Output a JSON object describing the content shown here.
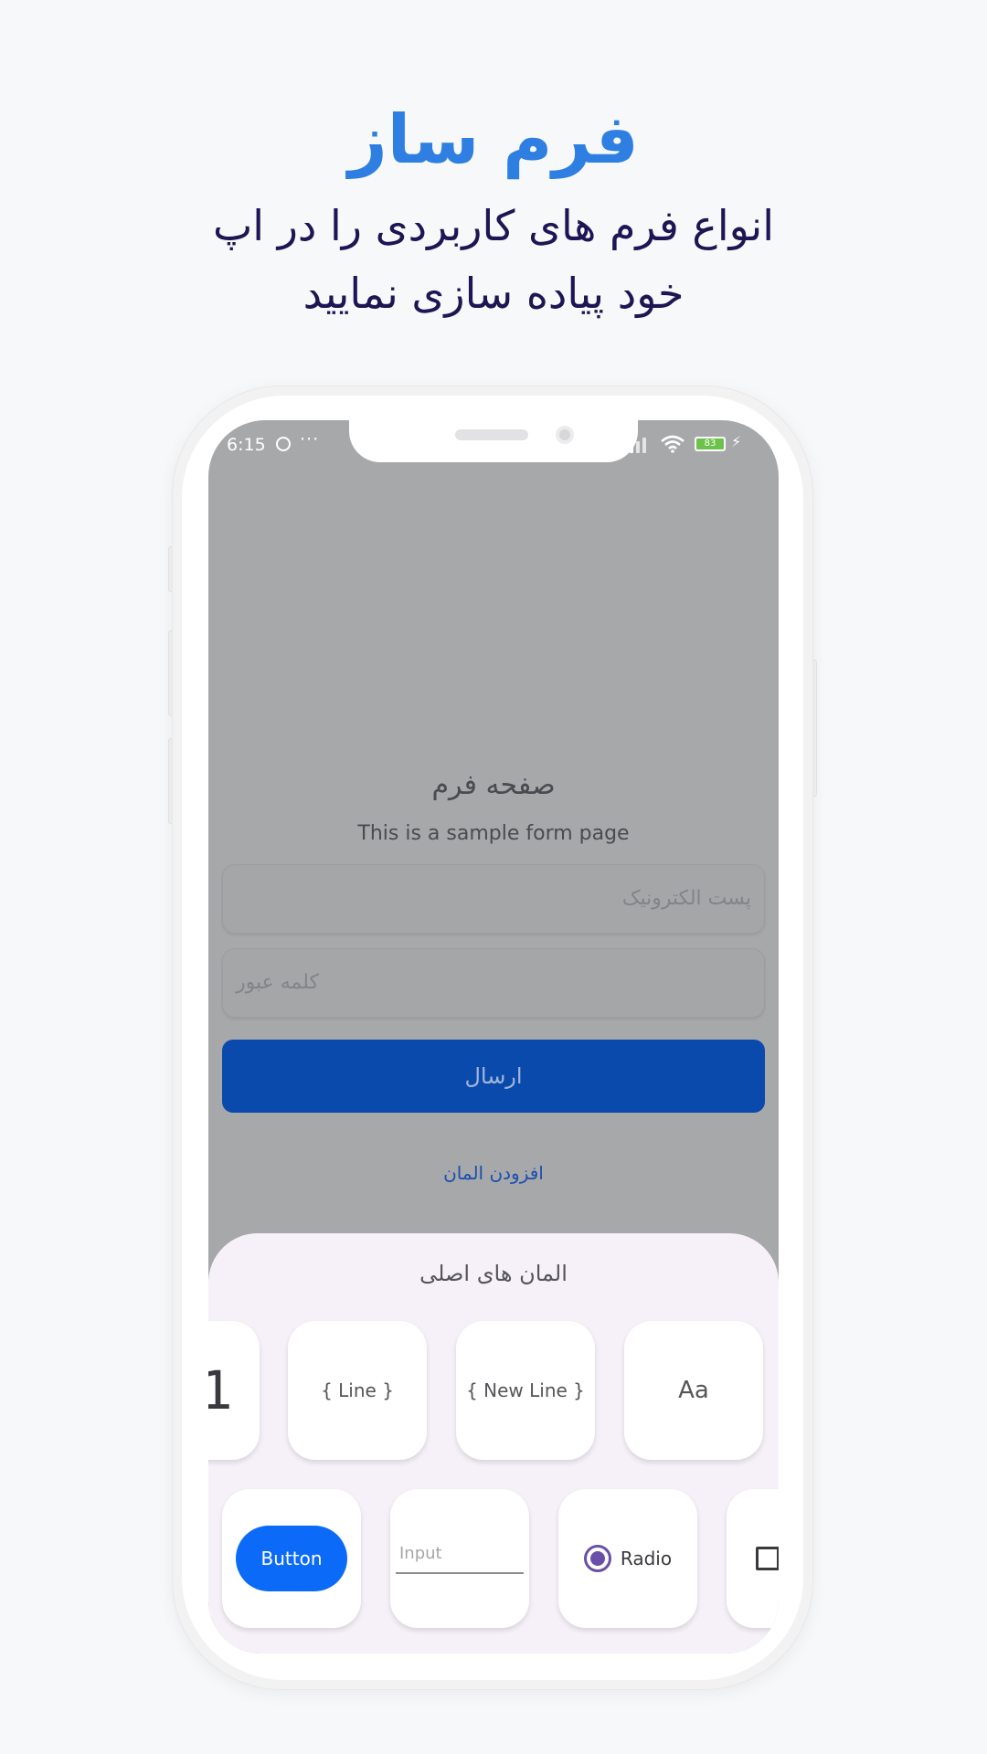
{
  "hero": {
    "title": "فرم ساز",
    "subtitle_line1": "انواع فرم های کاربردی را در اپ",
    "subtitle_line2": "خود پیاده سازی نمایید"
  },
  "status_bar": {
    "time": "6:15",
    "more": "···",
    "battery": "83"
  },
  "form": {
    "title": "صفحه فرم",
    "subtitle": "This is a sample form page",
    "email_placeholder": "پست الکترونیک",
    "password_placeholder": "کلمه عبور",
    "submit_label": "ارسال",
    "add_element_label": "افزودن المان"
  },
  "sheet": {
    "title": "المان های اصلی",
    "row1": [
      {
        "label": "Aa"
      },
      {
        "label": "{ New Line }"
      },
      {
        "label": "{ Line }"
      },
      {
        "label": "1"
      }
    ],
    "row2": {
      "button_label": "Button",
      "input_placeholder": "Input",
      "radio_label": "Radio"
    }
  },
  "colors": {
    "accent": "#2f7fe3",
    "heading": "#1c1654",
    "submit": "#0a4aad",
    "demo_button": "#0b6af7",
    "radio": "#6a4fa8"
  }
}
